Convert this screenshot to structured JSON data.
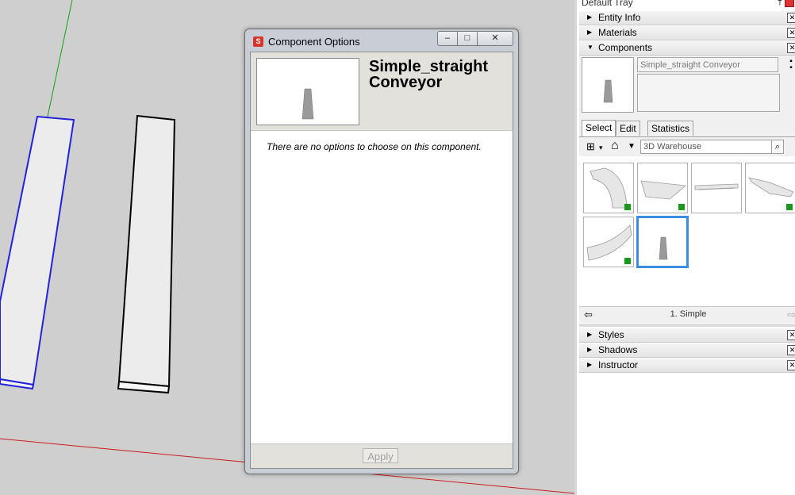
{
  "dialog": {
    "title": "Component Options",
    "min_glyph": "–",
    "max_glyph": "□",
    "close_glyph": "✕",
    "component_name": "Simple_straight Conveyor",
    "message": "There are no options to choose on this component.",
    "apply_label": "Apply"
  },
  "tray": {
    "title": "Default Tray",
    "pin_glyph": "†",
    "panels_top": [
      {
        "label": "Entity Info",
        "arrow": "▶"
      },
      {
        "label": "Materials",
        "arrow": "▶"
      },
      {
        "label": "Components",
        "arrow": "▼"
      }
    ],
    "panels_bottom": [
      {
        "label": "Styles",
        "arrow": "▶"
      },
      {
        "label": "Shadows",
        "arrow": "▶"
      },
      {
        "label": "Instructor",
        "arrow": "▶"
      }
    ],
    "close_glyph": "✕"
  },
  "components": {
    "name_value": "Simple_straight Conveyor",
    "tabs": [
      {
        "label": "Select",
        "active": true
      },
      {
        "label": "Edit",
        "active": false
      },
      {
        "label": "Statistics",
        "active": false
      }
    ],
    "search_value": "3D Warehouse",
    "search_icon": "search-icon",
    "view_icon": "grid-view-icon",
    "home_icon": "home-icon",
    "collection": "1. Simple",
    "back_icon": "back-arrow-icon",
    "forward_icon": "forward-arrow-icon",
    "items": [
      {
        "name": "curved-conveyor"
      },
      {
        "name": "angled-conveyor-flat"
      },
      {
        "name": "long-straight-conveyor"
      },
      {
        "name": "tapered-conveyor"
      },
      {
        "name": "curve-segment-conveyor"
      },
      {
        "name": "simple-straight-conveyor",
        "selected": true
      }
    ]
  },
  "colors": {
    "selection_blue": "#2222dd",
    "axis_green": "#14a014",
    "axis_red": "#c81e1e",
    "selected_border": "#3b8de0"
  }
}
